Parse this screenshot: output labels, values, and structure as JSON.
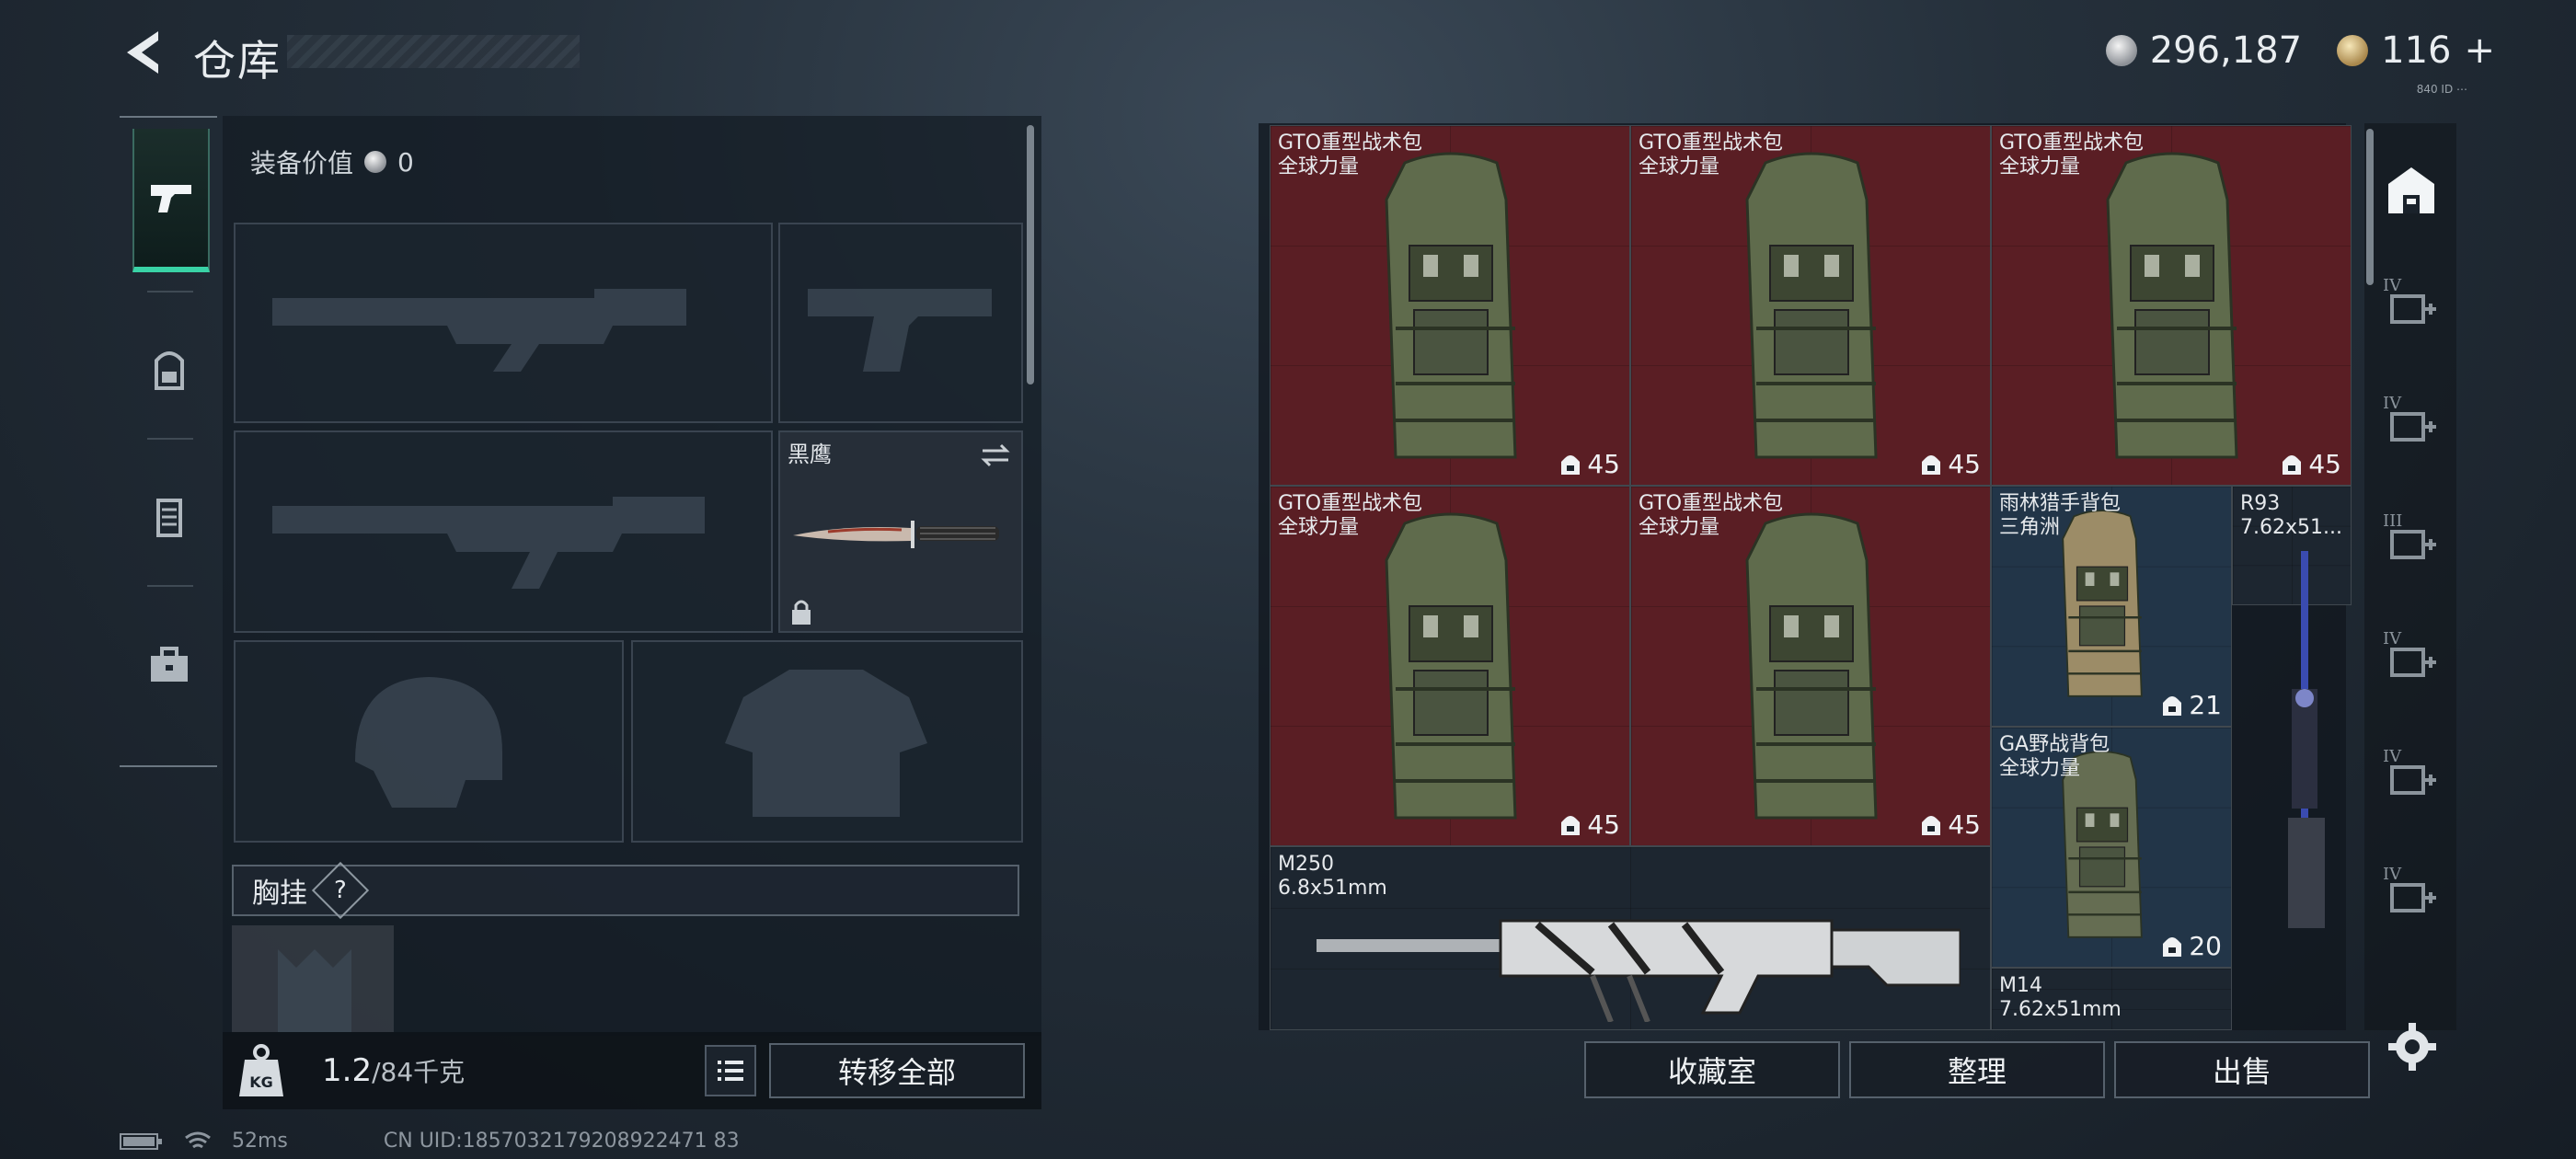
{
  "header": {
    "title": "仓库",
    "silver": "296,187",
    "gold": "116",
    "gold_plus": "+",
    "mini_text": "840 ID ⋯"
  },
  "left_nav": [
    {
      "icon": "pistol-icon",
      "active": true
    },
    {
      "icon": "backpack-icon"
    },
    {
      "icon": "vest-icon"
    },
    {
      "icon": "toolbox-icon"
    }
  ],
  "loadout": {
    "equip_value_label": "装备价值",
    "equip_value": "0",
    "knife_name": "黑鹰",
    "chest_label": "胸挂",
    "chest_help": "?"
  },
  "bottom": {
    "weight_current": "1.2",
    "weight_max": "/84千克",
    "transfer_all": "转移全部",
    "kg_label": "KG"
  },
  "status": {
    "ping": "52ms",
    "uid": "CN UID:1857032179208922471 83"
  },
  "inventory": {
    "items": [
      {
        "name": "GTO重型战术包\n全球力量",
        "capacity": "45",
        "color": "red"
      },
      {
        "name": "GTO重型战术包\n全球力量",
        "capacity": "45",
        "color": "red"
      },
      {
        "name": "GTO重型战术包\n全球力量",
        "capacity": "45",
        "color": "red"
      },
      {
        "name": "GTO重型战术包\n全球力量",
        "capacity": "45",
        "color": "red"
      },
      {
        "name": "GTO重型战术包\n全球力量",
        "capacity": "45",
        "color": "red"
      },
      {
        "name": "雨林猎手背包\n三角洲",
        "capacity": "21",
        "color": "blue"
      },
      {
        "name": "R93\n7.62x51...",
        "capacity": "",
        "color": "gray"
      },
      {
        "name": "GA野战背包\n全球力量",
        "capacity": "20",
        "color": "blue"
      },
      {
        "name": "M250\n6.8x51mm",
        "capacity": "",
        "color": "gray"
      },
      {
        "name": "M14\n7.62x51mm",
        "capacity": "",
        "color": "gray"
      }
    ]
  },
  "right_nav": [
    {
      "icon": "warehouse-icon",
      "tier": ""
    },
    {
      "icon": "medkit-add-icon",
      "tier": "IV"
    },
    {
      "icon": "medkit-add-icon",
      "tier": "IV"
    },
    {
      "icon": "armor-box-icon",
      "tier": "III"
    },
    {
      "icon": "folder-icon",
      "tier": "IV"
    },
    {
      "icon": "folder-icon",
      "tier": "IV"
    },
    {
      "icon": "crate-icon",
      "tier": "IV"
    }
  ],
  "actions": {
    "collection": "收藏室",
    "sort": "整理",
    "sell": "出售"
  }
}
